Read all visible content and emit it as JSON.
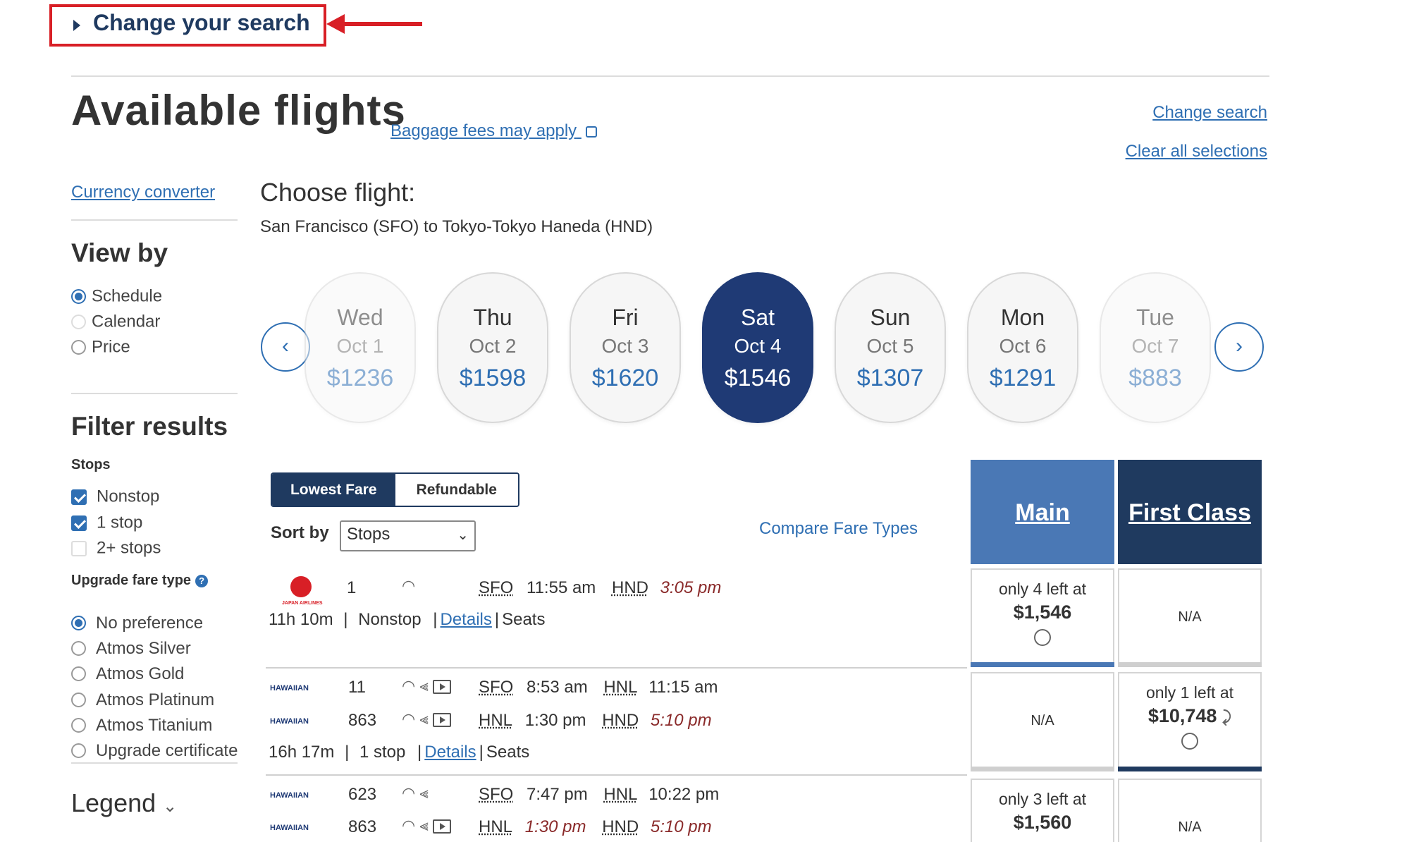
{
  "top": {
    "change_your_search": "Change your search"
  },
  "header": {
    "title": "Available flights",
    "baggage_link": "Baggage fees may apply",
    "change_search": "Change search",
    "clear_selections": "Clear all selections"
  },
  "sidebar": {
    "currency": "Currency converter",
    "view_by_title": "View by",
    "view_by": [
      {
        "label": "Schedule",
        "selected": true
      },
      {
        "label": "Calendar",
        "selected": false
      },
      {
        "label": "Price",
        "selected": false
      }
    ],
    "filter_title": "Filter results",
    "stops_label": "Stops",
    "stops": [
      {
        "label": "Nonstop",
        "checked": true
      },
      {
        "label": "1 stop",
        "checked": true
      },
      {
        "label": "2+ stops",
        "checked": false
      }
    ],
    "upgrade_label": "Upgrade fare type",
    "upgrade_options": [
      {
        "label": "No preference",
        "selected": true
      },
      {
        "label": "Atmos Silver",
        "selected": false
      },
      {
        "label": "Atmos Gold",
        "selected": false
      },
      {
        "label": "Atmos Platinum",
        "selected": false
      },
      {
        "label": "Atmos Titanium",
        "selected": false
      },
      {
        "label": "Upgrade certificate",
        "selected": false
      }
    ],
    "legend": "Legend"
  },
  "main": {
    "choose_flight": "Choose flight:",
    "route": "San Francisco (SFO) to Tokyo-Tokyo Haneda (HND)",
    "dates": [
      {
        "day": "Wed",
        "date": "Oct 1",
        "price": "$1236"
      },
      {
        "day": "Thu",
        "date": "Oct 2",
        "price": "$1598"
      },
      {
        "day": "Fri",
        "date": "Oct 3",
        "price": "$1620"
      },
      {
        "day": "Sat",
        "date": "Oct 4",
        "price": "$1546"
      },
      {
        "day": "Sun",
        "date": "Oct 5",
        "price": "$1307"
      },
      {
        "day": "Mon",
        "date": "Oct 6",
        "price": "$1291"
      },
      {
        "day": "Tue",
        "date": "Oct 7",
        "price": "$883"
      }
    ],
    "fare_toggle": {
      "lowest": "Lowest Fare",
      "refundable": "Refundable"
    },
    "sort_label": "Sort by",
    "sort_value": "Stops",
    "compare": "Compare Fare Types",
    "cabins": {
      "main": "Main",
      "first": "First Class"
    }
  },
  "flights": [
    {
      "segments": [
        {
          "airline": "JAPAN AIRLINES",
          "num": "1",
          "from": "SFO",
          "dep": "11:55 am",
          "to": "HND",
          "arr": "3:05 pm"
        }
      ],
      "duration": "11h 10m",
      "stops": "Nonstop",
      "details": "Details",
      "seats": "Seats",
      "main": {
        "line1": "only 4 left at",
        "price": "$1,546"
      },
      "first": {
        "na": "N/A"
      }
    },
    {
      "segments": [
        {
          "airline": "HAWAIIAN",
          "num": "11",
          "from": "SFO",
          "dep": "8:53 am",
          "to": "HNL",
          "arr": "11:15 am"
        },
        {
          "airline": "HAWAIIAN",
          "num": "863",
          "from": "HNL",
          "dep": "1:30 pm",
          "to": "HND",
          "arr": "5:10 pm"
        }
      ],
      "duration": "16h 17m",
      "stops": "1 stop",
      "details": "Details",
      "seats": "Seats",
      "main": {
        "na": "N/A"
      },
      "first": {
        "line1": "only 1 left at",
        "price": "$10,748"
      }
    },
    {
      "segments": [
        {
          "airline": "HAWAIIAN",
          "num": "623",
          "from": "SFO",
          "dep": "7:47 pm",
          "to": "HNL",
          "arr": "10:22 pm"
        },
        {
          "airline": "HAWAIIAN",
          "num": "863",
          "from": "HNL",
          "dep": "1:30 pm",
          "to": "HND",
          "arr": "5:10 pm"
        }
      ],
      "main": {
        "line1": "only 3 left at",
        "price": "$1,560"
      },
      "first": {
        "na": "N/A"
      }
    }
  ],
  "colors": {
    "accent": "#2f6fb3",
    "navy": "#1f3a75",
    "main_header": "#4a78b5",
    "first_header": "#1f3a5f",
    "annotation": "#d81f26"
  }
}
